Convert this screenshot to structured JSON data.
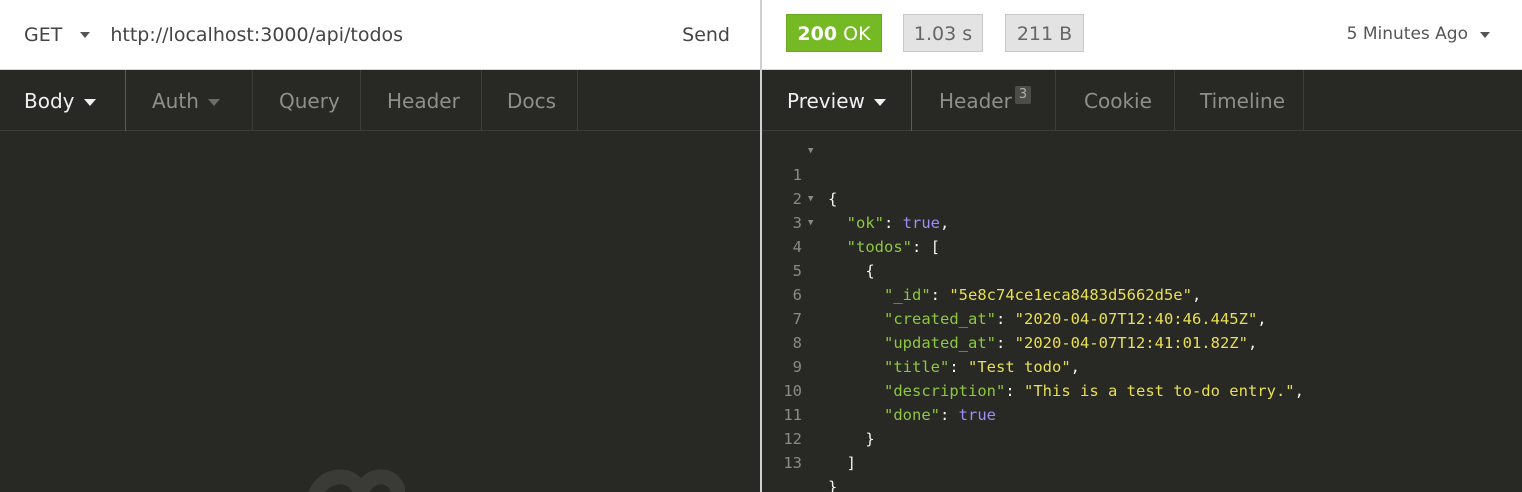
{
  "request": {
    "method": "GET",
    "url": "http://localhost:3000/api/todos",
    "send_label": "Send"
  },
  "response": {
    "status_code": "200",
    "status_text": "OK",
    "time": "1.03 s",
    "size": "211 B",
    "history": "5 Minutes Ago"
  },
  "request_tabs": {
    "body": "Body",
    "auth": "Auth",
    "query": "Query",
    "header": "Header",
    "docs": "Docs"
  },
  "response_tabs": {
    "preview": "Preview",
    "header": "Header",
    "header_count": "3",
    "cookie": "Cookie",
    "timeline": "Timeline"
  },
  "json_preview": {
    "line_numbers": [
      "1",
      "2",
      "3",
      "4",
      "5",
      "6",
      "7",
      "8",
      "9",
      "10",
      "11",
      "12",
      "13"
    ],
    "ok_key": "\"ok\"",
    "ok_value": "true",
    "todos_key": "\"todos\"",
    "id_key": "\"_id\"",
    "id_value": "\"5e8c74ce1eca8483d5662d5e\"",
    "created_key": "\"created_at\"",
    "created_value": "\"2020-04-07T12:40:46.445Z\"",
    "updated_key": "\"updated_at\"",
    "updated_value": "\"2020-04-07T12:41:01.82Z\"",
    "title_key": "\"title\"",
    "title_value": "\"Test todo\"",
    "description_key": "\"description\"",
    "description_value": "\"This is a test to-do entry.\"",
    "done_key": "\"done\"",
    "done_value": "true"
  },
  "colors": {
    "status_ok": "#75ba24",
    "json_key": "#8ec63f",
    "json_string": "#e8df52",
    "json_boolean": "#9d8cf3",
    "pane_background": "#282925"
  },
  "icons": {
    "method_dropdown": "chevron-down-icon",
    "history_dropdown": "chevron-down-icon",
    "fold_marker": "fold-triangle-icon",
    "watermark": "app-logo-watermark-icon"
  }
}
